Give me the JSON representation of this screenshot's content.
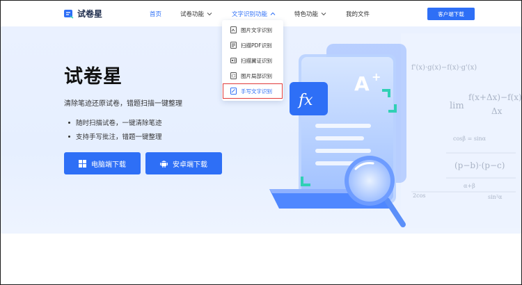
{
  "header": {
    "logo_text": "试卷星",
    "nav": [
      {
        "label": "首页"
      },
      {
        "label": "试卷功能"
      },
      {
        "label": "文字识别功能"
      },
      {
        "label": "特色功能"
      },
      {
        "label": "我的文件"
      }
    ],
    "client_button": "客户端下载"
  },
  "dropdown": {
    "items": [
      {
        "label": "图片文字识别"
      },
      {
        "label": "扫描PDF识别"
      },
      {
        "label": "扫描翼证识别"
      },
      {
        "label": "图片局部识别"
      },
      {
        "label": "手写文字识别"
      }
    ]
  },
  "hero": {
    "title": "试卷星",
    "subtitle": "清除笔迹还原试卷，错题扫描一键整理",
    "bullets": [
      "随时扫描试卷，一键清除笔迹",
      "支持手写批注，错题一键整理"
    ],
    "pc_download": "电脑端下载",
    "android_download": "安卓端下载",
    "illustration": {
      "fx_label": "fx",
      "grade_label": "A",
      "grade_plus": "+",
      "formulas": [
        "f'(x)·g(x)−f(x)·g'(x)",
        "f(x+Δx)−f(x)",
        "Δx",
        "lim",
        "cosβ = sinα",
        "(p−b)·(p−c)",
        "α+β",
        "2cos",
        "sin²α"
      ]
    }
  },
  "colors": {
    "accent": "#2e6ff6",
    "highlight_border": "#e03a3a",
    "hero_bg": "#e8f0ff"
  }
}
